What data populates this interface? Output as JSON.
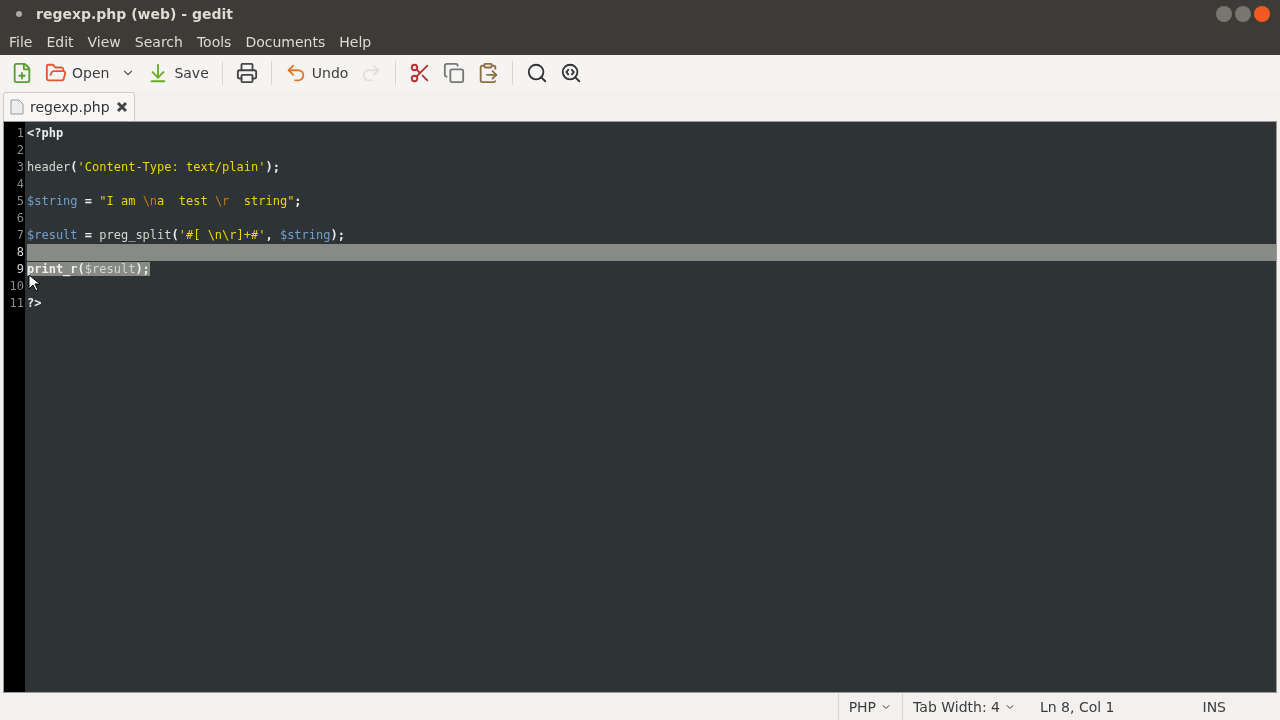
{
  "window": {
    "title": "regexp.php (web) - gedit"
  },
  "menu": [
    "File",
    "Edit",
    "View",
    "Search",
    "Tools",
    "Documents",
    "Help"
  ],
  "toolbar": [
    {
      "kind": "button",
      "disabled": false
    },
    {
      "kind": "button",
      "label": "Open",
      "disabled": false
    },
    {
      "kind": "dropdown"
    },
    {
      "kind": "button",
      "label": "Save",
      "disabled": false
    },
    {
      "kind": "separator"
    },
    {
      "kind": "button",
      "disabled": false
    },
    {
      "kind": "separator"
    },
    {
      "kind": "button",
      "label": "Undo",
      "disabled": false
    },
    {
      "kind": "button",
      "disabled": true
    },
    {
      "kind": "separator"
    },
    {
      "kind": "button",
      "disabled": false
    },
    {
      "kind": "button",
      "disabled": false
    },
    {
      "kind": "button",
      "disabled": false
    },
    {
      "kind": "separator"
    },
    {
      "kind": "button",
      "disabled": false
    },
    {
      "kind": "button",
      "disabled": false
    }
  ],
  "tabs": [
    {
      "label": "regexp.php",
      "selected": true
    }
  ],
  "lines": [
    {
      "number": "1",
      "selected": false,
      "tokens": [
        {
          "kind": "keyword",
          "text": "<?php"
        }
      ]
    },
    {
      "number": "2",
      "selected": false
    },
    {
      "number": "3",
      "selected": false,
      "tokens": [
        {
          "kind": "plain",
          "text": "header"
        },
        {
          "kind": "operator",
          "text": "("
        },
        {
          "kind": "string",
          "text": "'Content-Type: text/plain'"
        },
        {
          "kind": "operator",
          "text": ");"
        }
      ]
    },
    {
      "number": "4",
      "selected": false
    },
    {
      "number": "5",
      "selected": false,
      "tokens": [
        {
          "kind": "variable",
          "text": "$string"
        },
        {
          "kind": "operator",
          "text": " = "
        },
        {
          "kind": "string",
          "text": "\"I am "
        },
        {
          "kind": "escape",
          "text": "\\n"
        },
        {
          "kind": "string",
          "text": "a  test "
        },
        {
          "kind": "escape",
          "text": "\\r"
        },
        {
          "kind": "string",
          "text": "  string\""
        },
        {
          "kind": "operator",
          "text": ";"
        }
      ]
    },
    {
      "number": "6",
      "selected": false
    },
    {
      "number": "7",
      "selected": false,
      "tokens": [
        {
          "kind": "variable",
          "text": "$result"
        },
        {
          "kind": "operator",
          "text": " = "
        },
        {
          "kind": "plain",
          "text": "preg_split"
        },
        {
          "kind": "operator",
          "text": "("
        },
        {
          "kind": "string",
          "text": "'#[ \\n\\r]+#'"
        },
        {
          "kind": "operator",
          "text": ", "
        },
        {
          "kind": "variable",
          "text": "$string"
        },
        {
          "kind": "operator",
          "text": ");"
        }
      ]
    },
    {
      "number": "8",
      "selected": true
    },
    {
      "number": "9",
      "selected": true,
      "tokens": [
        {
          "kind": "keyword",
          "text": "print_r"
        },
        {
          "kind": "operator",
          "text": "("
        },
        {
          "kind": "plain",
          "text": "$result"
        },
        {
          "kind": "operator",
          "text": ");"
        }
      ]
    },
    {
      "number": "10",
      "selected": false
    },
    {
      "number": "11",
      "selected": false,
      "tokens": [
        {
          "kind": "keyword",
          "text": "?>"
        }
      ]
    }
  ],
  "status_bar": {
    "language": "PHP",
    "tab_width": "Tab Width:  4",
    "position": "Ln 8, Col 1",
    "mode": "INS"
  }
}
